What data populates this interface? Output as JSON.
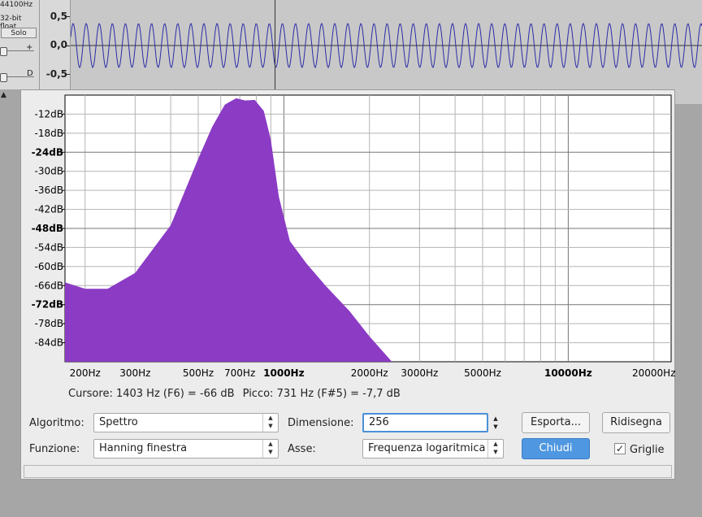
{
  "track": {
    "rate": "44100Hz",
    "format": "32-bit float",
    "solo_label": "Solo",
    "plus_glyph": "+",
    "pan_glyph": "D",
    "vruler": [
      "0,5",
      "0,0",
      "-0,5"
    ]
  },
  "info": {
    "cursor": "Cursore: 1403 Hz (F6) = -66 dB",
    "peak": "Picco: 731 Hz (F#5) = -7,7 dB"
  },
  "controls": {
    "algorithm_label": "Algoritmo:",
    "algorithm_value": "Spettro",
    "function_label": "Funzione:",
    "function_value": "Hanning finestra",
    "size_label": "Dimensione:",
    "size_value": "256",
    "axis_label": "Asse:",
    "axis_value": "Frequenza logaritmica",
    "export_label": "Esporta...",
    "replot_label": "Ridisegna",
    "close_label": "Chiudi",
    "grid_label": "Griglie",
    "grid_checked": true
  },
  "chart_data": {
    "type": "area",
    "x_scale": "log",
    "xlim": [
      170,
      23000
    ],
    "ylim": [
      -90,
      -6
    ],
    "grid": true,
    "fill_color": "#8b3bc4",
    "y_ticks": [
      {
        "value": -12,
        "label": "-12dB",
        "bold": false
      },
      {
        "value": -18,
        "label": "-18dB",
        "bold": false
      },
      {
        "value": -24,
        "label": "-24dB",
        "bold": true
      },
      {
        "value": -30,
        "label": "-30dB",
        "bold": false
      },
      {
        "value": -36,
        "label": "-36dB",
        "bold": false
      },
      {
        "value": -42,
        "label": "-42dB",
        "bold": false
      },
      {
        "value": -48,
        "label": "-48dB",
        "bold": true
      },
      {
        "value": -54,
        "label": "-54dB",
        "bold": false
      },
      {
        "value": -60,
        "label": "-60dB",
        "bold": false
      },
      {
        "value": -66,
        "label": "-66dB",
        "bold": false
      },
      {
        "value": -72,
        "label": "-72dB",
        "bold": true
      },
      {
        "value": -78,
        "label": "-78dB",
        "bold": false
      },
      {
        "value": -84,
        "label": "-84dB",
        "bold": false
      }
    ],
    "x_labels": [
      {
        "value": 200,
        "label": "200Hz",
        "bold": false
      },
      {
        "value": 300,
        "label": "300Hz",
        "bold": false
      },
      {
        "value": 500,
        "label": "500Hz",
        "bold": false
      },
      {
        "value": 700,
        "label": "700Hz",
        "bold": false
      },
      {
        "value": 1000,
        "label": "1000Hz",
        "bold": true
      },
      {
        "value": 2000,
        "label": "2000Hz",
        "bold": false
      },
      {
        "value": 3000,
        "label": "3000Hz",
        "bold": false
      },
      {
        "value": 5000,
        "label": "5000Hz",
        "bold": false
      },
      {
        "value": 10000,
        "label": "10000Hz",
        "bold": true
      },
      {
        "value": 20000,
        "label": "20000Hz",
        "bold": false
      }
    ],
    "x_grid": [
      200,
      300,
      400,
      500,
      600,
      700,
      800,
      900,
      1000,
      2000,
      3000,
      4000,
      5000,
      6000,
      7000,
      8000,
      9000,
      10000,
      20000
    ],
    "series": [
      {
        "x": [
          170,
          200,
          240,
          300,
          400,
          500,
          560,
          620,
          680,
          731,
          790,
          850,
          900,
          960,
          1050,
          1200,
          1400,
          1700,
          2000,
          2400
        ],
        "y": [
          -65,
          -67,
          -67,
          -62,
          -47,
          -26,
          -16,
          -9,
          -7,
          -7.7,
          -7.5,
          -11,
          -20,
          -38,
          -52,
          -59,
          -66,
          -74,
          -82,
          -90
        ]
      }
    ]
  }
}
